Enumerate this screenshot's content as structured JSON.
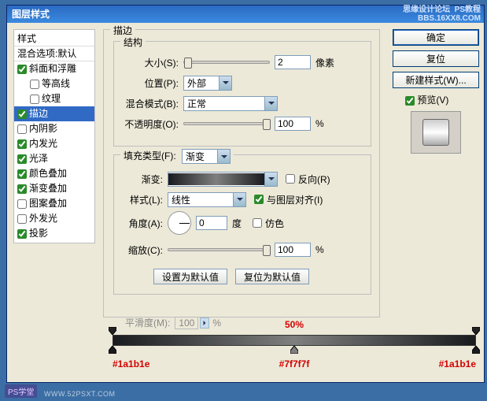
{
  "window": {
    "title": "图层样式",
    "watermark_top": "PS教程",
    "watermark_sub": "BBS.16XX8.COM",
    "watermark_forum": "思缘设计论坛"
  },
  "sidebar": {
    "header": "样式",
    "blend_options": "混合选项:默认",
    "items": [
      {
        "label": "斜面和浮雕",
        "checked": true,
        "indent": false
      },
      {
        "label": "等高线",
        "checked": false,
        "indent": true
      },
      {
        "label": "纹理",
        "checked": false,
        "indent": true
      },
      {
        "label": "描边",
        "checked": true,
        "indent": false,
        "selected": true
      },
      {
        "label": "内阴影",
        "checked": false,
        "indent": false
      },
      {
        "label": "内发光",
        "checked": true,
        "indent": false
      },
      {
        "label": "光泽",
        "checked": true,
        "indent": false
      },
      {
        "label": "颜色叠加",
        "checked": true,
        "indent": false
      },
      {
        "label": "渐变叠加",
        "checked": true,
        "indent": false
      },
      {
        "label": "图案叠加",
        "checked": false,
        "indent": false
      },
      {
        "label": "外发光",
        "checked": false,
        "indent": false
      },
      {
        "label": "投影",
        "checked": true,
        "indent": false
      }
    ]
  },
  "main": {
    "legend": "描边",
    "struct_legend": "结构",
    "size_label": "大小(S):",
    "size_value": "2",
    "size_unit": "像素",
    "position_label": "位置(P):",
    "position_value": "外部",
    "blend_label": "混合模式(B):",
    "blend_value": "正常",
    "opacity_label": "不透明度(O):",
    "opacity_value": "100",
    "opacity_unit": "%",
    "fill_legend": "填充类型(F):",
    "fill_value": "渐变",
    "grad_label": "渐变:",
    "reverse_label": "反向(R)",
    "style_label": "样式(L):",
    "style_value": "线性",
    "align_label": "与图层对齐(I)",
    "angle_label": "角度(A):",
    "angle_value": "0",
    "angle_unit": "度",
    "dither_label": "仿色",
    "scale_label": "缩放(C):",
    "scale_value": "100",
    "scale_unit": "%",
    "btn_default": "设置为默认值",
    "btn_reset": "复位为默认值",
    "smooth_label": "平滑度(M):",
    "smooth_value": "100",
    "smooth_unit": "%"
  },
  "right": {
    "ok": "确定",
    "reset": "复位",
    "newstyle": "新建样式(W)...",
    "preview": "预览(V)"
  },
  "gradient": {
    "midpoint": "50%",
    "left_hex": "#1a1b1e",
    "mid_hex": "#7f7f7f",
    "right_hex": "#1a1b1e"
  },
  "footer": {
    "badge": "PS学堂",
    "url": "WWW.52PSXT.COM"
  }
}
